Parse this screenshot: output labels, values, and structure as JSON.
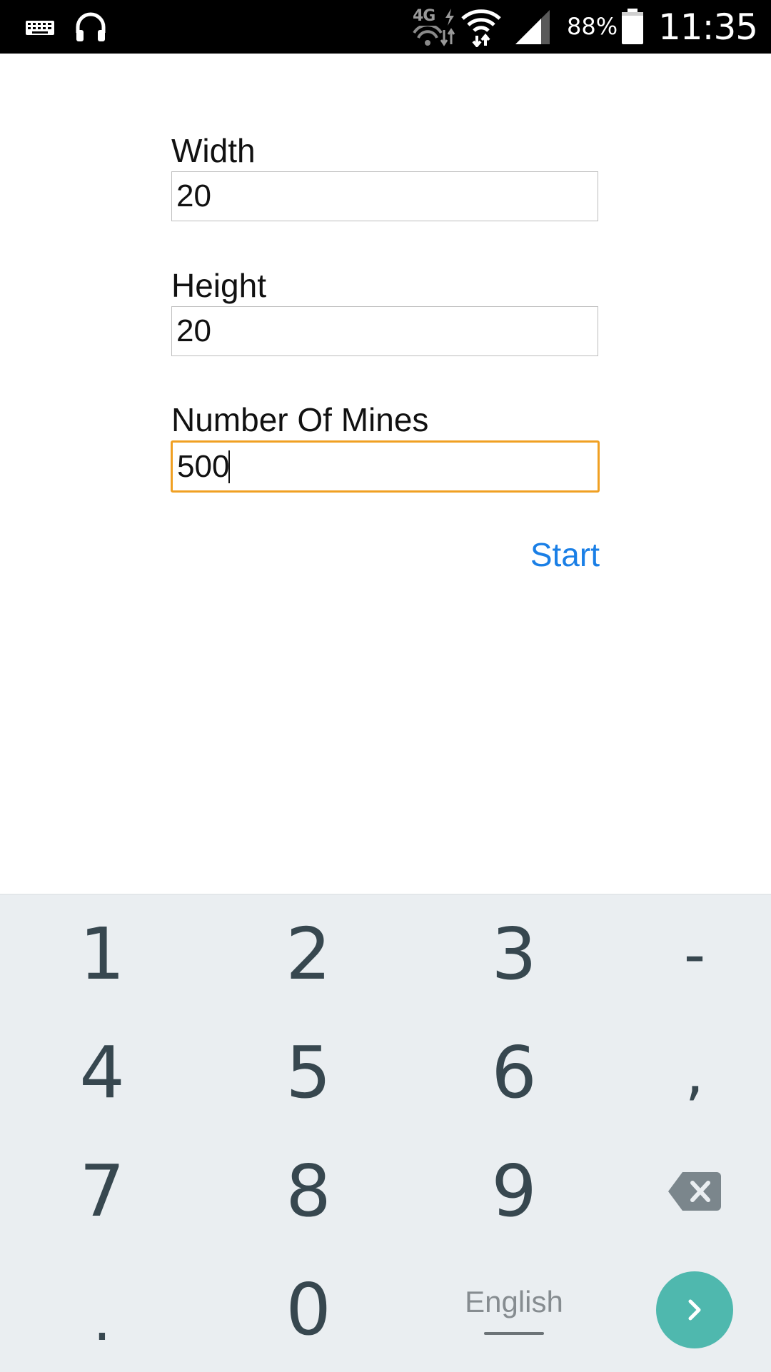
{
  "status_bar": {
    "network_type": "4G",
    "battery_percent": "88%",
    "time": "11:35",
    "icons": [
      "keyboard-icon",
      "headphones-icon",
      "4g-data-icon",
      "wifi-icon",
      "cell-signal-icon",
      "battery-icon"
    ]
  },
  "form": {
    "width_label": "Width",
    "width_value": "20",
    "height_label": "Height",
    "height_value": "20",
    "mines_label": "Number Of Mines",
    "mines_value": "500",
    "focused_field": "mines",
    "start_label": "Start"
  },
  "keyboard": {
    "keys": {
      "k1": "1",
      "k2": "2",
      "k3": "3",
      "dash": "-",
      "k4": "4",
      "k5": "5",
      "k6": "6",
      "comma": ",",
      "k7": "7",
      "k8": "8",
      "k9": "9",
      "period": ".",
      "k0": "0"
    },
    "language": "English",
    "icons": [
      "backspace-icon",
      "enter-arrow-icon"
    ]
  },
  "colors": {
    "focus_border": "#f0a023",
    "link": "#1a7fe6",
    "keyboard_bg": "#eaeef1",
    "key_text": "#37474f",
    "enter_button": "#4fb8ae"
  }
}
